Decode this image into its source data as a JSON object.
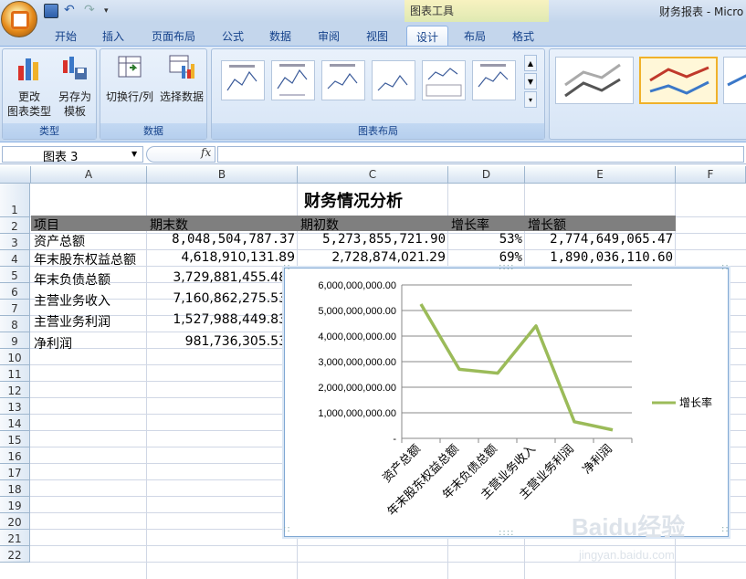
{
  "window": {
    "app_title": "财务报表 - Micro",
    "context_tools": "图表工具"
  },
  "tabs": [
    "开始",
    "插入",
    "页面布局",
    "公式",
    "数据",
    "审阅",
    "视图",
    "设计",
    "布局",
    "格式"
  ],
  "ribbon": {
    "type_group": {
      "label": "类型",
      "change_type": [
        "更改",
        "图表类型"
      ],
      "save_template": [
        "另存为",
        "模板"
      ]
    },
    "data_group": {
      "label": "数据",
      "switch": "切换行/列",
      "select": "选择数据"
    },
    "layout_group": {
      "label": "图表布局"
    }
  },
  "formula_bar": {
    "name_box": "图表 3",
    "fx": "fx"
  },
  "columns": [
    "A",
    "B",
    "C",
    "D",
    "E",
    "F"
  ],
  "rows": [
    "1",
    "2",
    "3",
    "4",
    "5",
    "6",
    "7",
    "8",
    "9",
    "10",
    "11",
    "12",
    "13",
    "14",
    "15",
    "16",
    "17",
    "18",
    "19",
    "20",
    "21",
    "22"
  ],
  "sheet": {
    "title": "财务情况分析",
    "headers": [
      "项目",
      "期末数",
      "期初数",
      "增长率",
      "增长额"
    ],
    "data": [
      {
        "item": "资产总额",
        "end": "8,048,504,787.37",
        "begin": "5,273,855,721.90",
        "rate": "53%",
        "delta": "2,774,649,065.47"
      },
      {
        "item": "年末股东权益总额",
        "end": "4,618,910,131.89",
        "begin": "2,728,874,021.29",
        "rate": "69%",
        "delta": "1,890,036,110.60"
      },
      {
        "item": "年末负债总额",
        "end": "3,729,881,455.48",
        "begin": "",
        "rate": "",
        "delta": ""
      },
      {
        "item": "主营业务收入",
        "end": "7,160,862,275.53",
        "begin": "",
        "rate": "",
        "delta": ""
      },
      {
        "item": "主营业务利润",
        "end": "1,527,988,449.83",
        "begin": "",
        "rate": "",
        "delta": ""
      },
      {
        "item": "净利润",
        "end": "981,736,305.53",
        "begin": "",
        "rate": "",
        "delta": ""
      }
    ]
  },
  "chart_data": {
    "type": "line",
    "categories": [
      "资产总额",
      "年末股东权益总额",
      "年末负债总额",
      "主营业务收入",
      "主营业务利润",
      "净利润"
    ],
    "series": [
      {
        "name": "增长率",
        "values": [
          5250000000,
          2700000000,
          2550000000,
          4400000000,
          650000000,
          330000000
        ],
        "color": "#9bbb59"
      }
    ],
    "y_ticks": [
      "-",
      "1,000,000,000.00",
      "2,000,000,000.00",
      "3,000,000,000.00",
      "4,000,000,000.00",
      "5,000,000,000.00",
      "6,000,000,000.00"
    ],
    "ylim": [
      0,
      6000000000
    ],
    "legend": "right",
    "grid": true
  },
  "watermark": {
    "brand": "Baidu经验",
    "url": "jingyan.baidu.com"
  }
}
